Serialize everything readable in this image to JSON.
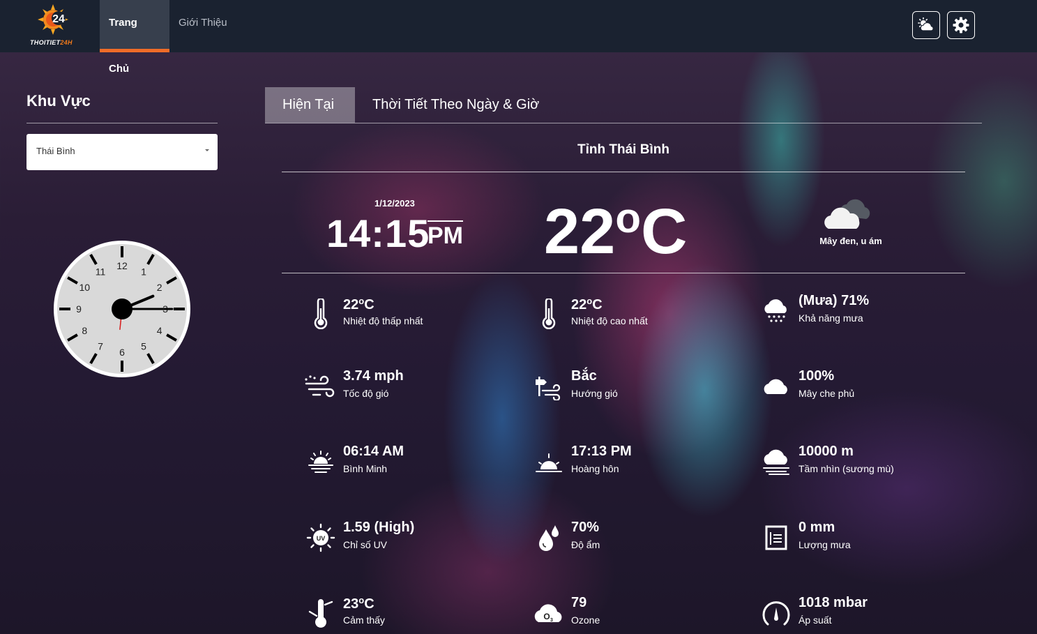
{
  "nav": {
    "logo_text_main": "THOITIET",
    "logo_text_accent": "24H",
    "tabs": [
      {
        "label": "Trang Chủ"
      },
      {
        "label": "Giới Thiệu"
      }
    ],
    "buttons": [
      {
        "icon": "weather-icon"
      },
      {
        "icon": "gear-icon"
      }
    ]
  },
  "sidebar": {
    "title": "Khu Vực",
    "select_value": "Thái Bình",
    "clock": {
      "hour": 2,
      "minute": 15,
      "second": 31
    }
  },
  "main": {
    "tabs": [
      {
        "label": "Hiện Tại"
      },
      {
        "label": "Thời Tiết Theo Ngày & Giờ"
      }
    ],
    "location": "Tỉnh Thái Bình",
    "date": "1/12/2023",
    "time": "14:15",
    "ampm": "PM",
    "temperature": "22",
    "temp_unit": "C",
    "condition": "Mây đen, u ám",
    "stats": [
      {
        "value": "22",
        "unit": "C",
        "label": "Nhiệt độ thấp nhất",
        "icon": "thermometer-icon"
      },
      {
        "value": "22",
        "unit": "C",
        "label": "Nhiệt độ cao nhất",
        "icon": "thermometer-icon"
      },
      {
        "value": "(Mưa) 71%",
        "label": "Khả năng mưa",
        "icon": "rain-cloud-icon"
      },
      {
        "value": "3.74 mph",
        "label": "Tốc độ gió",
        "icon": "wind-icon"
      },
      {
        "value": "Bắc",
        "label": "Hướng gió",
        "icon": "wind-direction-icon"
      },
      {
        "value": "100%",
        "label": "Mây che phủ",
        "icon": "cloud-icon"
      },
      {
        "value": "06:14 AM",
        "label": "Bình Minh",
        "icon": "sunrise-icon"
      },
      {
        "value": "17:13 PM",
        "label": "Hoàng hôn",
        "icon": "sunset-icon"
      },
      {
        "value": "10000 m",
        "label": "Tầm nhìn (sương mù)",
        "icon": "fog-icon"
      },
      {
        "value": "1.59 (High)",
        "label": "Chỉ số UV",
        "icon": "uv-icon"
      },
      {
        "value": "70%",
        "label": "Độ ẩm",
        "icon": "humidity-icon"
      },
      {
        "value": "0 mm",
        "label": "Lượng mưa",
        "icon": "rain-gauge-icon"
      },
      {
        "value": "23",
        "unit": "C",
        "label": "Cảm thấy",
        "icon": "feels-like-icon"
      },
      {
        "value": "79",
        "label": "Ozone",
        "icon": "ozone-icon"
      },
      {
        "value": "1018 mbar",
        "label": "Áp suất",
        "icon": "pressure-gauge-icon"
      }
    ]
  }
}
